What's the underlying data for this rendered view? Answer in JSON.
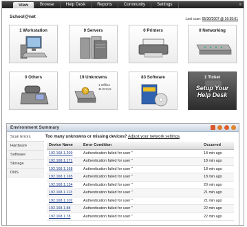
{
  "nav": {
    "tabs": [
      "View",
      "Browse",
      "Help Desk",
      "Reports",
      "Community",
      "Settings"
    ],
    "active": "View",
    "corner_mark": "≡"
  },
  "header": {
    "site_name": "School@net",
    "last_scan_label": "Last scan:",
    "last_scan_value": "05/30/2007 @ 16:39:01"
  },
  "tiles": [
    {
      "label": "1 Workstation",
      "icon": "workstation-icon"
    },
    {
      "label": "0 Servers",
      "icon": "server-icon"
    },
    {
      "label": "0 Printers",
      "icon": "printer-icon"
    },
    {
      "label": "0 Networking",
      "icon": "network-switch-icon"
    },
    {
      "label": "0 Others",
      "icon": "phone-icon"
    },
    {
      "label": "19 Unknowns",
      "icon": "unknown-device-icon",
      "note1": "1 Offline",
      "note2": "11 Errors"
    },
    {
      "label": "83 Software",
      "icon": "software-box-icon"
    },
    {
      "label": "1 Ticket",
      "icon": "helpdesk-icon",
      "promo": "Setup Your Help Desk"
    }
  ],
  "env": {
    "title": "Environment Summary",
    "sidenav": [
      "Scan Errors",
      "Hardware",
      "Software",
      "Storage",
      "DNS"
    ],
    "active_side": "Scan Errors",
    "alert_text": "Too many unknowns or missing devices?",
    "alert_link": "Adjust your network settings",
    "alert_end": ".",
    "columns": [
      "Device Name",
      "Error Condition",
      "Occurred"
    ],
    "rows": [
      [
        "192.168.1.209",
        "Authentication failed for user \"",
        "18 min ago"
      ],
      [
        "192.168.1.171",
        "Authentication failed for user \"",
        "18 min ago"
      ],
      [
        "192.168.1.168",
        "Authentication failed for user \"",
        "18 min ago"
      ],
      [
        "192.168.1.165",
        "Authentication failed for user \"",
        "18 min ago"
      ],
      [
        "192.168.1.134",
        "Authentication failed for user \"",
        "20 min ago"
      ],
      [
        "192.168.1.113",
        "Authentication failed for user \"",
        "21 min ago"
      ],
      [
        "192.168.1.102",
        "Authentication failed for user \"",
        "21 min ago"
      ],
      [
        "192.168.1.88",
        "Authentication failed for user \"",
        "22 min ago"
      ],
      [
        "192.168.1.78",
        "Authentication failed for user \"",
        "22 min ago"
      ]
    ],
    "header_icon_colors": [
      "#d9582b",
      "#e07a2b",
      "#e05c2b",
      "#e0872b"
    ]
  }
}
